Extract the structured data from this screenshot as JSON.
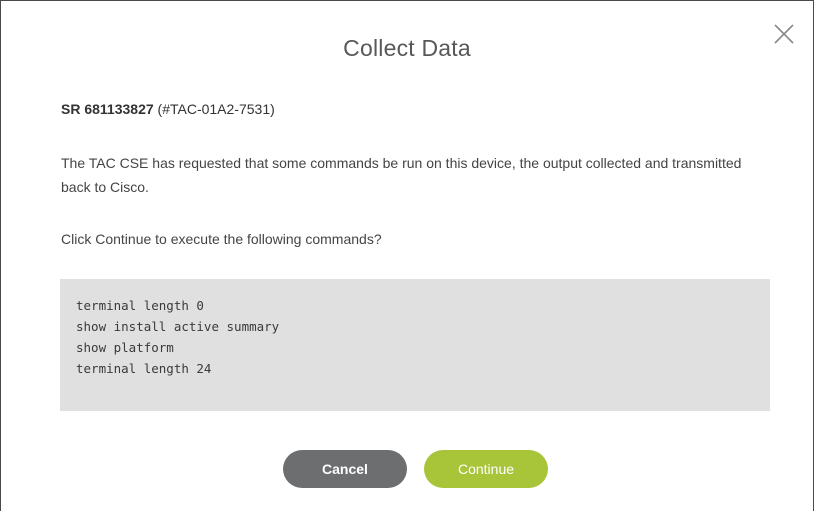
{
  "dialog": {
    "title": "Collect Data",
    "close_icon": "close-icon",
    "sr_number": "SR 681133827",
    "sr_ref": "(#TAC-01A2-7531)",
    "description": "The TAC CSE has requested that some commands be run on this device, the output collected and transmitted back to Cisco.",
    "prompt": "Click Continue to execute the following commands?",
    "commands": [
      "terminal length 0",
      "show install active summary",
      "show platform",
      "terminal length 24"
    ],
    "cancel_label": "Cancel",
    "continue_label": "Continue"
  },
  "colors": {
    "cancel_bg": "#6d6e70",
    "continue_bg": "#a8c53a",
    "command_box_bg": "#e0e0e0"
  }
}
